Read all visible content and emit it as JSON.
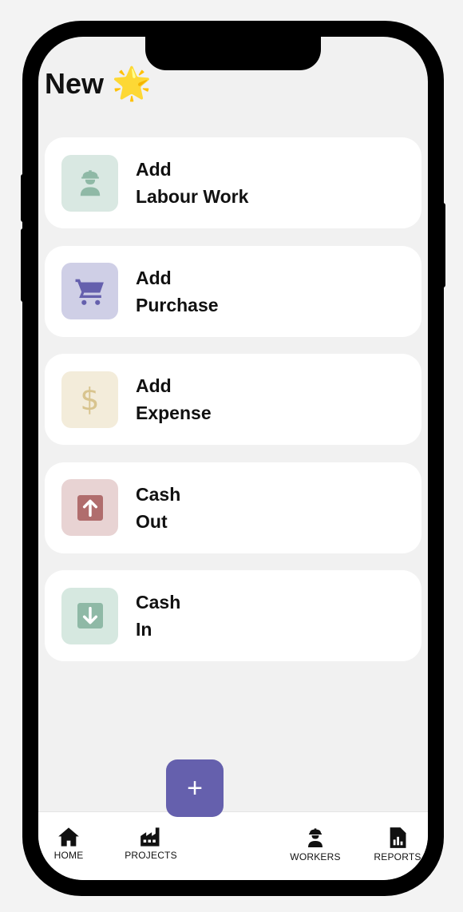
{
  "header": {
    "title": "New",
    "title_emoji": "🌟"
  },
  "actions": [
    {
      "line1": "Add",
      "line2": "Labour Work",
      "icon": "worker-icon",
      "tile_color": "#d9e8e2",
      "icon_color": "#8fb9a6"
    },
    {
      "line1": "Add",
      "line2": "Purchase",
      "icon": "cart-icon",
      "tile_color": "#cfcfe6",
      "icon_color": "#6560ad"
    },
    {
      "line1": "Add",
      "line2": "Expense",
      "icon": "dollar-icon",
      "tile_color": "#f3ecda",
      "icon_color": "#d8c48e"
    },
    {
      "line1": "Cash",
      "line2": "Out",
      "icon": "arrow-up-box-icon",
      "tile_color": "#e8d3d3",
      "icon_color": "#b06d6d"
    },
    {
      "line1": "Cash",
      "line2": "In",
      "icon": "arrow-down-box-icon",
      "tile_color": "#d6e8e0",
      "icon_color": "#8fb9a6"
    }
  ],
  "fab": {
    "label": "+"
  },
  "nav": [
    {
      "label": "HOME",
      "icon": "home-icon"
    },
    {
      "label": "PROJECTS",
      "icon": "factory-icon"
    },
    {
      "label": "WORKERS",
      "icon": "worker-icon"
    },
    {
      "label": "REPORTS",
      "icon": "report-icon"
    }
  ]
}
